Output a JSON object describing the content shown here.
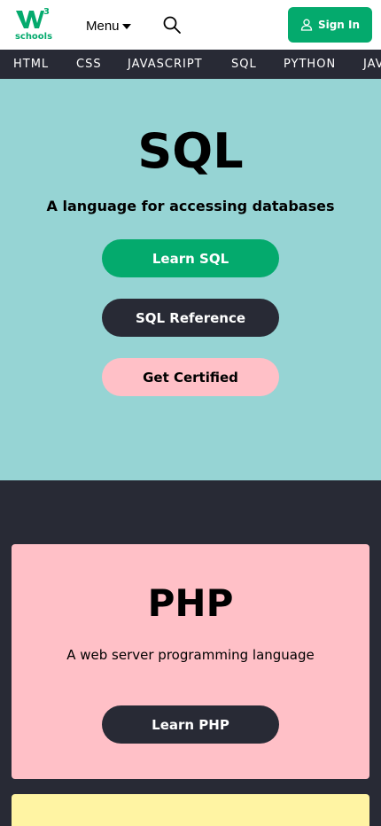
{
  "header": {
    "logo_text": "schools",
    "logo_superscript": "3",
    "menu_label": "Menu",
    "signin_label": "Sign In",
    "brand_color": "#04AA6D"
  },
  "subnav": {
    "items": [
      "HTML",
      "CSS",
      "JAVASCRIPT",
      "SQL",
      "PYTHON",
      "JAVA"
    ]
  },
  "hero": {
    "title": "SQL",
    "subtitle": "A language for accessing databases",
    "buttons": {
      "learn": "Learn SQL",
      "reference": "SQL Reference",
      "certified": "Get Certified"
    },
    "background": "#96D4D4"
  },
  "php_card": {
    "title": "PHP",
    "subtitle": "A web server programming language",
    "button": "Learn PHP",
    "background": "#FFC0C7"
  },
  "colors": {
    "dark": "#282A35",
    "pink": "#FFC0C7",
    "yellow": "#FFF4A3"
  }
}
